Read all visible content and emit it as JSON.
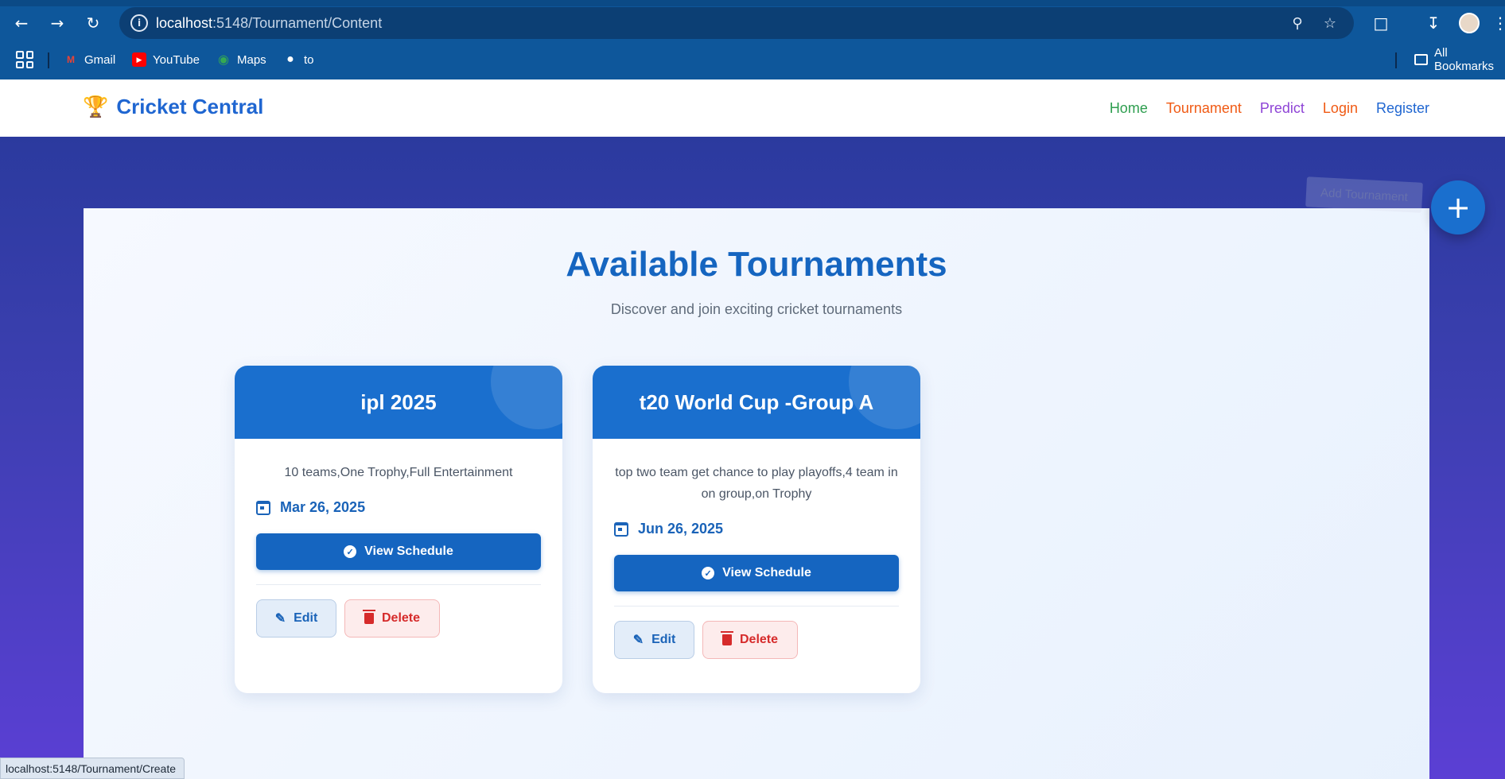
{
  "browser": {
    "url_host": "localhost",
    "url_rest": ":5148/Tournament/Content",
    "bookmarks": [
      {
        "label": "Gmail",
        "icon": "gmail-icon",
        "color": "#ea4335"
      },
      {
        "label": "YouTube",
        "icon": "youtube-icon",
        "color": "#ff0000"
      },
      {
        "label": "Maps",
        "icon": "maps-icon",
        "color": "#34a853"
      },
      {
        "label": "to",
        "icon": "globe-icon",
        "color": "#ffffff"
      }
    ],
    "all_bookmarks": "All Bookmarks",
    "status_url": "localhost:5148/Tournament/Create"
  },
  "site": {
    "brand": "Cricket Central",
    "brand_color": "#1f66d1",
    "nav": [
      {
        "label": "Home",
        "color": "#2e9e4f"
      },
      {
        "label": "Tournament",
        "color": "#f05a14"
      },
      {
        "label": "Predict",
        "color": "#8e44d6"
      },
      {
        "label": "Login",
        "color": "#f05a14"
      },
      {
        "label": "Register",
        "color": "#1f66d1"
      }
    ]
  },
  "main": {
    "title": "Available Tournaments",
    "subtitle": "Discover and join exciting cricket tournaments",
    "add_tooltip": "Add Tournament",
    "add_button": "+",
    "tournaments": [
      {
        "name": "ipl 2025",
        "description": "10 teams,One Trophy,Full Entertainment",
        "date": "Mar 26, 2025",
        "view_label": "View Schedule",
        "edit_label": "Edit",
        "delete_label": "Delete"
      },
      {
        "name": "t20 World Cup -Group A",
        "description": "top two team get chance to play playoffs,4 team in on group,on Trophy",
        "date": "Jun 26, 2025",
        "view_label": "View Schedule",
        "edit_label": "Edit",
        "delete_label": "Delete"
      }
    ]
  }
}
